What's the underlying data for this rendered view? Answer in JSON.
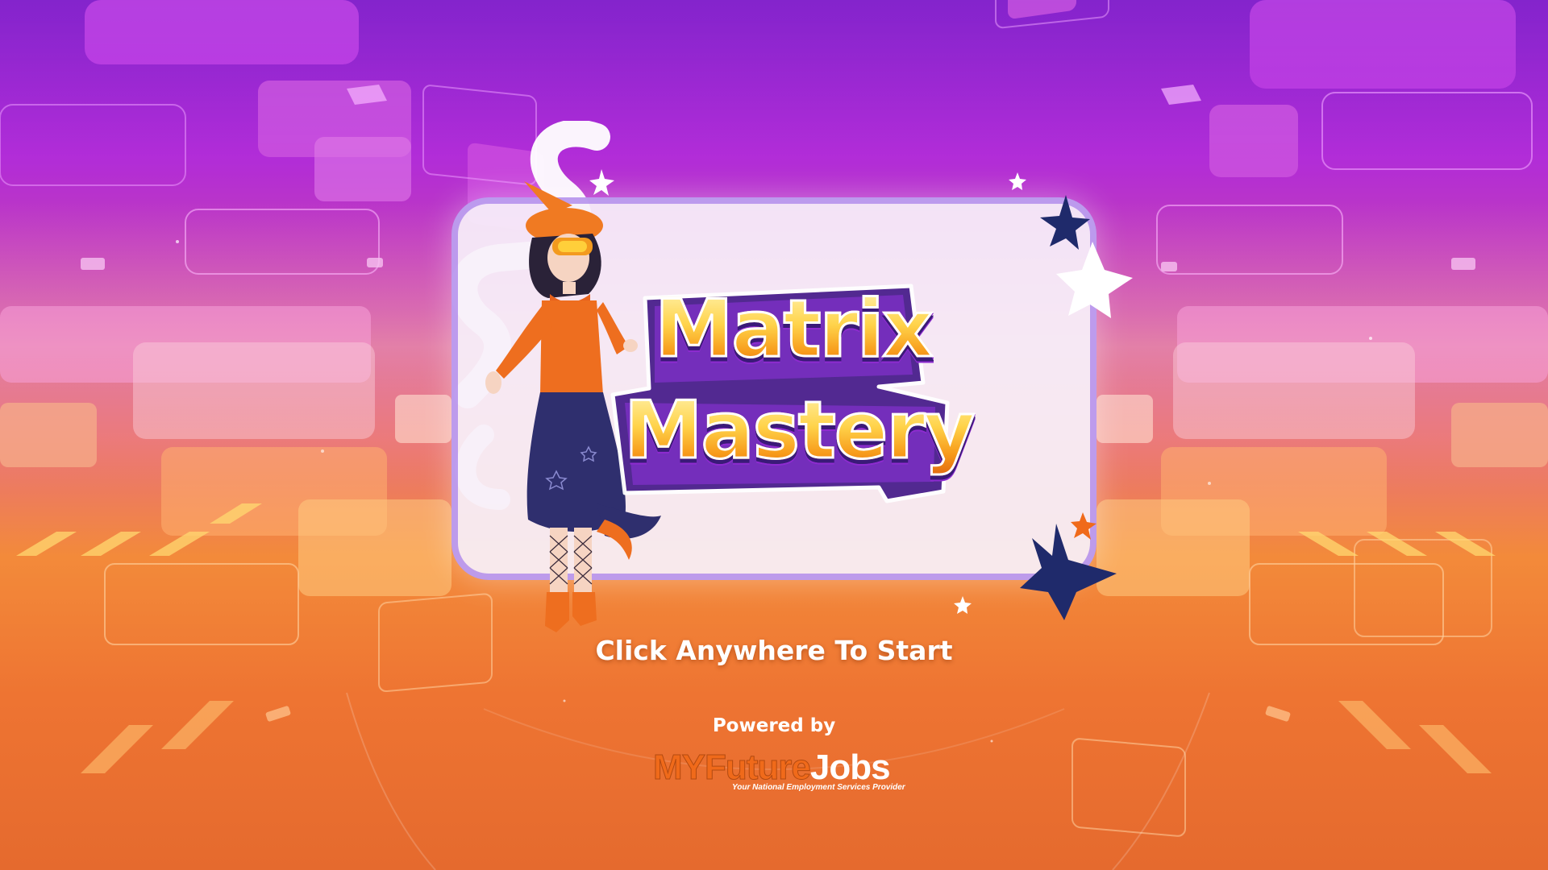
{
  "game": {
    "title_line_1": "Matrix",
    "title_line_2": "Mastery",
    "start_prompt": "Click Anywhere To Start",
    "powered_by": "Powered by",
    "brand": {
      "part_1": "MYFuture",
      "part_2": "Jobs",
      "tagline": "Your National Employment Services Provider"
    }
  },
  "colors": {
    "background_top": "#7a12c8",
    "background_bottom": "#e56a2e",
    "title_gold": "#ffd34a",
    "title_outline": "#3a1a78",
    "brand_orange": "#f06a1a",
    "star_navy": "#1f2a6b"
  },
  "icons": {
    "decor_stars": "star-icon",
    "character": "witch-character"
  }
}
